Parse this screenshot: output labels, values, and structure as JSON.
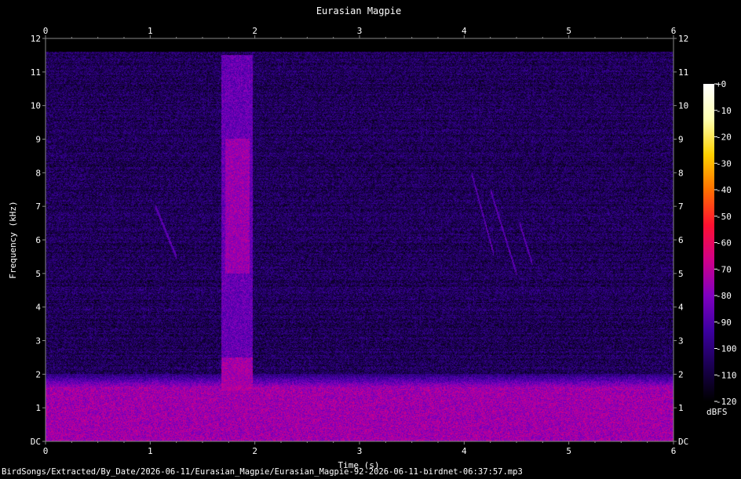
{
  "chart_data": {
    "type": "heatmap",
    "title": "Eurasian Magpie",
    "xlabel": "Time (s)",
    "ylabel": "Frequency (kHz)",
    "xlim": [
      0,
      6
    ],
    "ylim": [
      0,
      12
    ],
    "x_ticks": [
      "0",
      "1",
      "2",
      "3",
      "4",
      "5",
      "6"
    ],
    "y_ticks": [
      "DC",
      "1",
      "2",
      "3",
      "4",
      "5",
      "6",
      "7",
      "8",
      "9",
      "10",
      "11",
      "12"
    ],
    "colorbar": {
      "label": "dBFS",
      "range": [
        -120,
        0
      ],
      "ticks": [
        "+0",
        "-10",
        "-20",
        "-30",
        "-40",
        "-50",
        "-60",
        "-70",
        "-80",
        "-90",
        "-100",
        "-110",
        "-120"
      ],
      "colors": [
        "#000000",
        "#1a0050",
        "#3c00a0",
        "#8000c0",
        "#d0008a",
        "#ff1030",
        "#ff7000",
        "#ffd000",
        "#ffffb0",
        "#ffffff"
      ]
    },
    "signal_cutoff_khz": 11.6,
    "background_level_dbfs": -105,
    "low_band": {
      "freq_khz": [
        0,
        1.6
      ],
      "level_dbfs": -75
    },
    "events": [
      {
        "t": [
          1.68,
          1.98
        ],
        "f": [
          1.5,
          11.5
        ],
        "level_dbfs": -85
      },
      {
        "t": [
          1.72,
          1.95
        ],
        "f": [
          5.0,
          9.0
        ],
        "level_dbfs": -76
      },
      {
        "t": [
          1.68,
          1.98
        ],
        "f": [
          1.5,
          2.5
        ],
        "level_dbfs": -74
      }
    ],
    "streaks": [
      {
        "t": [
          1.05,
          1.25
        ],
        "f": [
          7.0,
          5.5
        ]
      },
      {
        "t": [
          4.07,
          4.28
        ],
        "f": [
          8.0,
          5.6
        ]
      },
      {
        "t": [
          4.25,
          4.5
        ],
        "f": [
          7.5,
          5.0
        ]
      },
      {
        "t": [
          4.53,
          4.65
        ],
        "f": [
          6.5,
          5.3
        ]
      }
    ]
  },
  "footer": {
    "file_path": "BirdSongs/Extracted/By_Date/2026-06-11/Eurasian_Magpie/Eurasian_Magpie-92-2026-06-11-birdnet-06:37:57.mp3"
  }
}
